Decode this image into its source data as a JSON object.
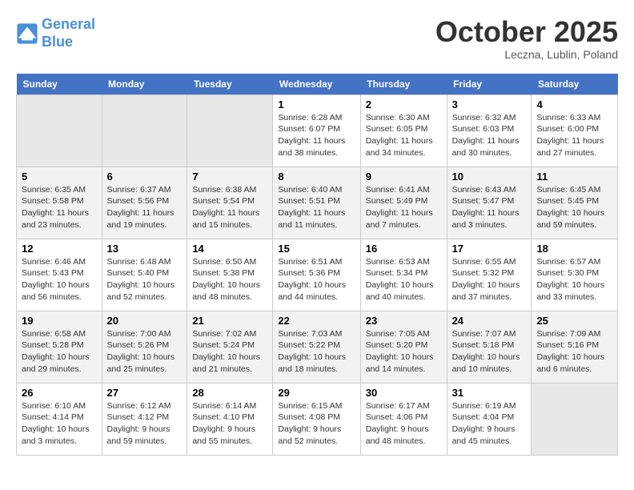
{
  "header": {
    "logo_line1": "General",
    "logo_line2": "Blue",
    "month": "October 2025",
    "location": "Leczna, Lublin, Poland"
  },
  "days_of_week": [
    "Sunday",
    "Monday",
    "Tuesday",
    "Wednesday",
    "Thursday",
    "Friday",
    "Saturday"
  ],
  "weeks": [
    [
      {
        "num": "",
        "info": ""
      },
      {
        "num": "",
        "info": ""
      },
      {
        "num": "",
        "info": ""
      },
      {
        "num": "1",
        "info": "Sunrise: 6:28 AM\nSunset: 6:07 PM\nDaylight: 11 hours\nand 38 minutes."
      },
      {
        "num": "2",
        "info": "Sunrise: 6:30 AM\nSunset: 6:05 PM\nDaylight: 11 hours\nand 34 minutes."
      },
      {
        "num": "3",
        "info": "Sunrise: 6:32 AM\nSunset: 6:03 PM\nDaylight: 11 hours\nand 30 minutes."
      },
      {
        "num": "4",
        "info": "Sunrise: 6:33 AM\nSunset: 6:00 PM\nDaylight: 11 hours\nand 27 minutes."
      }
    ],
    [
      {
        "num": "5",
        "info": "Sunrise: 6:35 AM\nSunset: 5:58 PM\nDaylight: 11 hours\nand 23 minutes."
      },
      {
        "num": "6",
        "info": "Sunrise: 6:37 AM\nSunset: 5:56 PM\nDaylight: 11 hours\nand 19 minutes."
      },
      {
        "num": "7",
        "info": "Sunrise: 6:38 AM\nSunset: 5:54 PM\nDaylight: 11 hours\nand 15 minutes."
      },
      {
        "num": "8",
        "info": "Sunrise: 6:40 AM\nSunset: 5:51 PM\nDaylight: 11 hours\nand 11 minutes."
      },
      {
        "num": "9",
        "info": "Sunrise: 6:41 AM\nSunset: 5:49 PM\nDaylight: 11 hours\nand 7 minutes."
      },
      {
        "num": "10",
        "info": "Sunrise: 6:43 AM\nSunset: 5:47 PM\nDaylight: 11 hours\nand 3 minutes."
      },
      {
        "num": "11",
        "info": "Sunrise: 6:45 AM\nSunset: 5:45 PM\nDaylight: 10 hours\nand 59 minutes."
      }
    ],
    [
      {
        "num": "12",
        "info": "Sunrise: 6:46 AM\nSunset: 5:43 PM\nDaylight: 10 hours\nand 56 minutes."
      },
      {
        "num": "13",
        "info": "Sunrise: 6:48 AM\nSunset: 5:40 PM\nDaylight: 10 hours\nand 52 minutes."
      },
      {
        "num": "14",
        "info": "Sunrise: 6:50 AM\nSunset: 5:38 PM\nDaylight: 10 hours\nand 48 minutes."
      },
      {
        "num": "15",
        "info": "Sunrise: 6:51 AM\nSunset: 5:36 PM\nDaylight: 10 hours\nand 44 minutes."
      },
      {
        "num": "16",
        "info": "Sunrise: 6:53 AM\nSunset: 5:34 PM\nDaylight: 10 hours\nand 40 minutes."
      },
      {
        "num": "17",
        "info": "Sunrise: 6:55 AM\nSunset: 5:32 PM\nDaylight: 10 hours\nand 37 minutes."
      },
      {
        "num": "18",
        "info": "Sunrise: 6:57 AM\nSunset: 5:30 PM\nDaylight: 10 hours\nand 33 minutes."
      }
    ],
    [
      {
        "num": "19",
        "info": "Sunrise: 6:58 AM\nSunset: 5:28 PM\nDaylight: 10 hours\nand 29 minutes."
      },
      {
        "num": "20",
        "info": "Sunrise: 7:00 AM\nSunset: 5:26 PM\nDaylight: 10 hours\nand 25 minutes."
      },
      {
        "num": "21",
        "info": "Sunrise: 7:02 AM\nSunset: 5:24 PM\nDaylight: 10 hours\nand 21 minutes."
      },
      {
        "num": "22",
        "info": "Sunrise: 7:03 AM\nSunset: 5:22 PM\nDaylight: 10 hours\nand 18 minutes."
      },
      {
        "num": "23",
        "info": "Sunrise: 7:05 AM\nSunset: 5:20 PM\nDaylight: 10 hours\nand 14 minutes."
      },
      {
        "num": "24",
        "info": "Sunrise: 7:07 AM\nSunset: 5:18 PM\nDaylight: 10 hours\nand 10 minutes."
      },
      {
        "num": "25",
        "info": "Sunrise: 7:09 AM\nSunset: 5:16 PM\nDaylight: 10 hours\nand 6 minutes."
      }
    ],
    [
      {
        "num": "26",
        "info": "Sunrise: 6:10 AM\nSunset: 4:14 PM\nDaylight: 10 hours\nand 3 minutes."
      },
      {
        "num": "27",
        "info": "Sunrise: 6:12 AM\nSunset: 4:12 PM\nDaylight: 9 hours\nand 59 minutes."
      },
      {
        "num": "28",
        "info": "Sunrise: 6:14 AM\nSunset: 4:10 PM\nDaylight: 9 hours\nand 55 minutes."
      },
      {
        "num": "29",
        "info": "Sunrise: 6:15 AM\nSunset: 4:08 PM\nDaylight: 9 hours\nand 52 minutes."
      },
      {
        "num": "30",
        "info": "Sunrise: 6:17 AM\nSunset: 4:06 PM\nDaylight: 9 hours\nand 48 minutes."
      },
      {
        "num": "31",
        "info": "Sunrise: 6:19 AM\nSunset: 4:04 PM\nDaylight: 9 hours\nand 45 minutes."
      },
      {
        "num": "",
        "info": ""
      }
    ]
  ]
}
